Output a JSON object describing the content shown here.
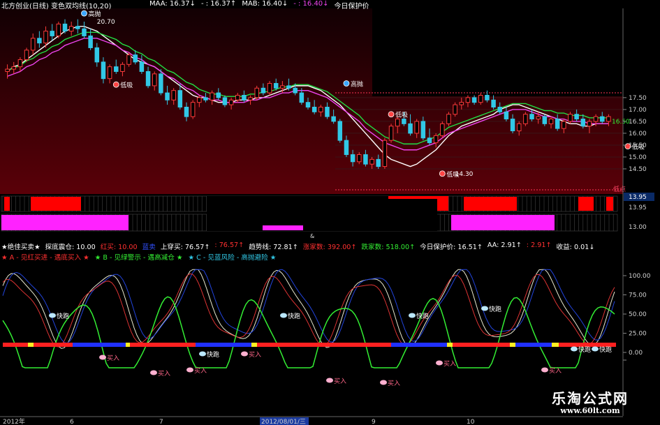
{
  "colors": {
    "background": "#000000",
    "main_panel_top": "#000000",
    "main_panel_bottom": "#5a0008",
    "up": "#ff3b3b",
    "down": "#31c8e6",
    "ma_white": "#ffffff",
    "ma_green": "#22dd44",
    "ma_magenta": "#ee44ee",
    "band_red": "#ff0000",
    "band_magenta": "#ff22ff",
    "gridline": "#3a1518",
    "axis_text": "#d0d0d0",
    "ind_red": "#ff3030",
    "ind_blue": "#2030ff",
    "ind_yellow": "#ffee22",
    "ind_green": "#33ee33",
    "watermark": "#ffffff"
  },
  "main_chart": {
    "title": "北方创业(日线) 变色双均线(10,20)",
    "legend": [
      {
        "label": "MAA: 16.37",
        "arrow": "↓",
        "color": "#ffffff"
      },
      {
        "label": "- : 16.37",
        "arrow": "↑",
        "color": "#ffffff"
      },
      {
        "label": "MAB: 16.40",
        "arrow": "↓",
        "color": "#ffffff"
      },
      {
        "label": "- : 16.40",
        "arrow": "↓",
        "color": "#ee44ee"
      },
      {
        "label": "今日保护价",
        "arrow": "",
        "color": "#ffffff"
      }
    ],
    "price_axis": [
      "17.50",
      "17.00",
      "16.50",
      "16.00",
      "15.50",
      "15.00",
      "14.50",
      "13.95",
      "13.00"
    ],
    "current_price_tag": "16.50",
    "ymin": 13.5,
    "ymax": 21.2,
    "annotations": [
      {
        "label": "高抛",
        "idx": 12,
        "price": 21.05,
        "kind": "sell"
      },
      {
        "label": "20.70",
        "idx": 14,
        "price": 20.7,
        "kind": "value"
      },
      {
        "label": "低吸",
        "idx": 17,
        "price": 18.05,
        "kind": "buy"
      },
      {
        "label": "高抛",
        "idx": 53,
        "price": 18.1,
        "kind": "sell"
      },
      {
        "label": "低吸",
        "idx": 60,
        "price": 16.8,
        "kind": "buy"
      },
      {
        "label": "低吸",
        "idx": 68,
        "price": 14.3,
        "kind": "buy"
      },
      {
        "label": "14.30",
        "idx": 70,
        "price": 14.3,
        "kind": "value"
      },
      {
        "label": "低吸",
        "idx": 97,
        "price": 15.45,
        "kind": "buy"
      }
    ],
    "low_marker": "低点",
    "stars": "★★"
  },
  "chart_data": {
    "type": "candlestick",
    "title": "北方创业(日线) 变色双均线(10,20)",
    "ylim": [
      13.5,
      21.2
    ],
    "series": [
      {
        "name": "MAA",
        "values": [
          18.6,
          18.8,
          18.9,
          19.1,
          19.3,
          19.5,
          19.7,
          19.9,
          20.1,
          20.3,
          20.4,
          20.5,
          20.5,
          20.4,
          20.3,
          20.1,
          19.9,
          19.7,
          19.5,
          19.3,
          19.1,
          19.0,
          18.9,
          18.8,
          18.6,
          18.4,
          18.2,
          18.0,
          17.8,
          17.6,
          17.5,
          17.5,
          17.4,
          17.3,
          17.3,
          17.3,
          17.4,
          17.4,
          17.4,
          17.5,
          17.5,
          17.6,
          17.7,
          17.8,
          17.9,
          18.0,
          18.0,
          18.0,
          17.9,
          17.8,
          17.6,
          17.4,
          17.2,
          16.9,
          16.6,
          16.3,
          16.0,
          15.7,
          15.4,
          15.1,
          14.9,
          14.8,
          14.7,
          14.6,
          14.7,
          14.9,
          15.1,
          15.3,
          15.6,
          15.9,
          16.1,
          16.3,
          16.4,
          16.5,
          16.6,
          16.7,
          16.8,
          17.0,
          17.1,
          17.2,
          17.2,
          17.1,
          17.0,
          16.9,
          16.8,
          16.7,
          16.6,
          16.5,
          16.4,
          16.4,
          16.3,
          16.3,
          16.4,
          16.4,
          16.4
        ]
      },
      {
        "name": "MAB",
        "values": [
          18.4,
          18.5,
          18.6,
          18.8,
          18.9,
          19.1,
          19.2,
          19.4,
          19.5,
          19.7,
          19.8,
          19.9,
          20.0,
          20.0,
          20.0,
          19.9,
          19.8,
          19.7,
          19.5,
          19.4,
          19.2,
          19.1,
          18.9,
          18.8,
          18.6,
          18.4,
          18.3,
          18.1,
          17.9,
          17.8,
          17.6,
          17.5,
          17.4,
          17.4,
          17.3,
          17.3,
          17.3,
          17.3,
          17.4,
          17.4,
          17.5,
          17.5,
          17.6,
          17.7,
          17.7,
          17.8,
          17.8,
          17.8,
          17.7,
          17.6,
          17.5,
          17.3,
          17.1,
          16.9,
          16.7,
          16.5,
          16.2,
          16.0,
          15.8,
          15.6,
          15.5,
          15.4,
          15.3,
          15.3,
          15.3,
          15.4,
          15.5,
          15.6,
          15.8,
          16.0,
          16.1,
          16.2,
          16.3,
          16.4,
          16.5,
          16.6,
          16.7,
          16.8,
          16.9,
          17.0,
          17.0,
          17.0,
          16.9,
          16.8,
          16.7,
          16.7,
          16.6,
          16.6,
          16.5,
          16.5,
          16.5,
          16.4,
          16.4,
          16.4,
          16.4
        ]
      }
    ],
    "candles": [
      [
        18.6,
        18.9,
        18.3,
        18.7
      ],
      [
        18.7,
        19.0,
        18.5,
        18.8
      ],
      [
        18.8,
        19.2,
        18.6,
        19.1
      ],
      [
        19.1,
        19.6,
        19.0,
        19.5
      ],
      [
        19.5,
        20.2,
        19.3,
        20.0
      ],
      [
        20.0,
        20.3,
        19.6,
        19.8
      ],
      [
        19.8,
        20.5,
        19.6,
        20.3
      ],
      [
        20.3,
        20.6,
        19.9,
        20.1
      ],
      [
        20.1,
        20.7,
        20.0,
        20.6
      ],
      [
        20.6,
        20.8,
        20.2,
        20.3
      ],
      [
        20.3,
        20.7,
        20.1,
        20.5
      ],
      [
        20.5,
        20.8,
        20.2,
        20.4
      ],
      [
        20.4,
        20.7,
        20.0,
        20.1
      ],
      [
        20.1,
        20.4,
        19.5,
        19.6
      ],
      [
        19.6,
        19.8,
        18.8,
        19.0
      ],
      [
        19.0,
        19.2,
        18.1,
        18.3
      ],
      [
        18.3,
        18.9,
        18.1,
        18.8
      ],
      [
        18.8,
        19.1,
        18.5,
        18.6
      ],
      [
        18.6,
        19.0,
        18.4,
        18.9
      ],
      [
        18.9,
        19.4,
        18.8,
        19.3
      ],
      [
        19.3,
        19.5,
        18.9,
        19.0
      ],
      [
        19.0,
        19.3,
        18.5,
        18.6
      ],
      [
        18.6,
        18.8,
        17.9,
        18.0
      ],
      [
        18.0,
        18.6,
        17.8,
        18.5
      ],
      [
        18.5,
        18.7,
        17.6,
        17.7
      ],
      [
        17.7,
        18.0,
        17.2,
        17.4
      ],
      [
        17.4,
        17.9,
        17.2,
        17.8
      ],
      [
        17.8,
        18.1,
        17.0,
        17.1
      ],
      [
        17.1,
        17.3,
        16.5,
        16.7
      ],
      [
        16.7,
        17.4,
        16.6,
        17.3
      ],
      [
        17.3,
        17.6,
        17.1,
        17.5
      ],
      [
        17.5,
        17.7,
        17.3,
        17.4
      ],
      [
        17.4,
        17.8,
        17.2,
        17.7
      ],
      [
        17.7,
        17.9,
        17.4,
        17.5
      ],
      [
        17.5,
        17.6,
        17.1,
        17.2
      ],
      [
        17.2,
        17.5,
        17.0,
        17.4
      ],
      [
        17.4,
        17.7,
        17.3,
        17.6
      ],
      [
        17.6,
        17.8,
        17.3,
        17.4
      ],
      [
        17.4,
        17.6,
        17.2,
        17.5
      ],
      [
        17.5,
        18.0,
        17.4,
        17.9
      ],
      [
        17.9,
        18.1,
        17.6,
        17.7
      ],
      [
        17.7,
        18.2,
        17.6,
        18.1
      ],
      [
        18.1,
        18.3,
        17.8,
        17.9
      ],
      [
        17.9,
        18.2,
        17.7,
        18.0
      ],
      [
        18.0,
        18.3,
        17.8,
        17.9
      ],
      [
        17.9,
        18.1,
        17.6,
        17.7
      ],
      [
        17.7,
        17.9,
        17.2,
        17.3
      ],
      [
        17.3,
        17.5,
        17.0,
        17.1
      ],
      [
        17.1,
        17.4,
        16.8,
        16.9
      ],
      [
        16.9,
        17.2,
        16.7,
        17.1
      ],
      [
        17.1,
        17.3,
        16.6,
        16.7
      ],
      [
        16.7,
        17.0,
        16.4,
        16.5
      ],
      [
        16.5,
        16.6,
        15.6,
        15.7
      ],
      [
        15.7,
        15.9,
        15.0,
        15.1
      ],
      [
        15.1,
        15.3,
        14.6,
        14.8
      ],
      [
        14.8,
        15.2,
        14.7,
        15.1
      ],
      [
        15.1,
        15.3,
        14.6,
        14.7
      ],
      [
        14.7,
        15.0,
        14.5,
        14.9
      ],
      [
        14.9,
        15.1,
        14.5,
        14.6
      ],
      [
        14.6,
        15.8,
        14.5,
        15.7
      ],
      [
        15.7,
        16.4,
        15.6,
        16.3
      ],
      [
        16.3,
        16.7,
        16.0,
        16.6
      ],
      [
        16.6,
        16.9,
        16.3,
        16.4
      ],
      [
        16.4,
        16.8,
        15.9,
        16.0
      ],
      [
        16.0,
        16.6,
        15.8,
        16.5
      ],
      [
        16.5,
        16.7,
        15.7,
        15.8
      ],
      [
        15.8,
        16.2,
        15.5,
        15.6
      ],
      [
        15.6,
        16.0,
        15.4,
        15.9
      ],
      [
        15.9,
        16.5,
        15.8,
        16.4
      ],
      [
        16.4,
        16.9,
        16.3,
        16.8
      ],
      [
        16.8,
        17.3,
        16.7,
        17.2
      ],
      [
        17.2,
        17.5,
        17.0,
        17.3
      ],
      [
        17.3,
        17.6,
        17.1,
        17.5
      ],
      [
        17.5,
        17.6,
        17.2,
        17.3
      ],
      [
        17.3,
        17.7,
        17.2,
        17.6
      ],
      [
        17.6,
        17.8,
        17.3,
        17.4
      ],
      [
        17.4,
        17.6,
        17.0,
        17.1
      ],
      [
        17.1,
        17.3,
        16.8,
        16.9
      ],
      [
        16.9,
        17.1,
        16.5,
        16.6
      ],
      [
        16.6,
        16.8,
        16.0,
        16.1
      ],
      [
        16.1,
        16.5,
        15.9,
        16.4
      ],
      [
        16.4,
        16.9,
        16.3,
        16.8
      ],
      [
        16.8,
        17.0,
        16.5,
        16.6
      ],
      [
        16.6,
        16.9,
        16.4,
        16.7
      ],
      [
        16.7,
        16.8,
        16.3,
        16.4
      ],
      [
        16.4,
        16.7,
        16.2,
        16.6
      ],
      [
        16.6,
        16.8,
        16.1,
        16.2
      ],
      [
        16.2,
        16.6,
        16.0,
        16.5
      ],
      [
        16.5,
        16.9,
        16.4,
        16.8
      ],
      [
        16.8,
        17.0,
        16.5,
        16.6
      ],
      [
        16.6,
        16.8,
        16.2,
        16.3
      ],
      [
        16.3,
        16.6,
        16.0,
        16.5
      ],
      [
        16.5,
        16.8,
        16.3,
        16.7
      ],
      [
        16.7,
        16.9,
        16.4,
        16.5
      ],
      [
        16.5,
        16.8,
        16.3,
        16.7
      ]
    ]
  },
  "bands": {
    "label_13_95": "13.95",
    "label_13_00": "13.00",
    "label_center": "&"
  },
  "indicator": {
    "header": [
      {
        "text": "★绝佳买卖★",
        "color": "#ffffff"
      },
      {
        "text": "探底震仓: 10.00",
        "color": "#ffffff"
      },
      {
        "text": "红买: 10.00",
        "color": "#ff3030"
      },
      {
        "text": "蓝卖",
        "color": "#3050ff"
      },
      {
        "text": "上穿买: 76.57",
        "arrow": "↑",
        "color": "#ffffff"
      },
      {
        "text": ": 76.57",
        "arrow": "↑",
        "color": "#ff3030"
      },
      {
        "text": "趋势线: 72.81",
        "arrow": "↑",
        "color": "#ffffff"
      },
      {
        "text": "涨家数: 392.00",
        "arrow": "↑",
        "color": "#ff3030"
      },
      {
        "text": "跌家数: 518.00",
        "arrow": "↑",
        "color": "#33ee33"
      },
      {
        "text": "今日保护价: 16.51",
        "arrow": "↑",
        "color": "#ffffff"
      },
      {
        "text": "AA: 2.91",
        "arrow": "↑",
        "color": "#ffffff"
      },
      {
        "text": ": 2.91",
        "arrow": "↑",
        "color": "#ff3030"
      },
      {
        "text": "收益: 0.01",
        "arrow": "↓",
        "color": "#ffffff"
      }
    ],
    "legend_line": [
      {
        "text": "★ A - 见红买进 - 遇底买入 ★",
        "color": "#ff3030"
      },
      {
        "text": "★ B - 见绿警示 - 遇高减仓 ★",
        "color": "#33ee33"
      },
      {
        "text": "★ C - 见蓝风险 - 高抛避险 ★",
        "color": "#31c8e6"
      }
    ],
    "axis": [
      "100.00",
      "75.00",
      "50.00",
      "25.00",
      "0.00"
    ],
    "signals": [
      {
        "label": "快跑",
        "x": 83,
        "y": 452
      },
      {
        "label": "快跑",
        "x": 414,
        "y": 452
      },
      {
        "label": "快跑",
        "x": 598,
        "y": 452
      },
      {
        "label": "快跑",
        "x": 702,
        "y": 442
      },
      {
        "label": "快跑",
        "x": 298,
        "y": 507
      },
      {
        "label": "快跑",
        "x": 830,
        "y": 500
      },
      {
        "label": "快跑",
        "x": 860,
        "y": 500
      },
      {
        "label": "买入",
        "x": 155,
        "y": 512
      },
      {
        "label": "买入",
        "x": 228,
        "y": 534
      },
      {
        "label": "买入",
        "x": 280,
        "y": 530
      },
      {
        "label": "买入",
        "x": 358,
        "y": 507
      },
      {
        "label": "买入",
        "x": 480,
        "y": 545
      },
      {
        "label": "买入",
        "x": 557,
        "y": 548
      },
      {
        "label": "买入",
        "x": 637,
        "y": 520
      },
      {
        "label": "买入",
        "x": 788,
        "y": 530
      }
    ]
  },
  "time_axis": {
    "labels": [
      {
        "text": "2012年",
        "x": 4
      },
      {
        "text": "6",
        "x": 100
      },
      {
        "text": "7",
        "x": 228
      },
      {
        "text": "2012/08/01/三",
        "x": 374,
        "selected": true
      },
      {
        "text": "9",
        "x": 532
      },
      {
        "text": "10",
        "x": 668
      }
    ]
  },
  "watermark": {
    "title": "乐淘公式网",
    "url": "www.60lt.com"
  }
}
